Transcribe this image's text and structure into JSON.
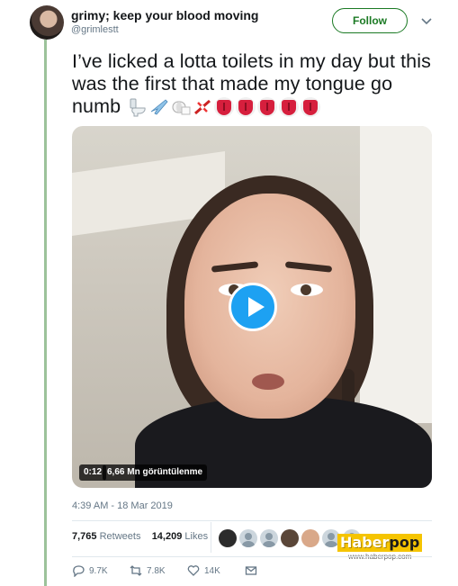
{
  "user": {
    "display_name": "grimy; keep your blood moving",
    "handle": "@grimlestt",
    "follow_label": "Follow"
  },
  "tweet": {
    "text": "I’ve licked a lotta toilets in my day but this was the first that made my tongue go numb",
    "emojis": [
      "toilet-emoji",
      "airplane-emoji",
      "toilet-paper-emoji",
      "small-airplane-emoji",
      "tongue-emoji",
      "tongue-emoji",
      "tongue-emoji",
      "tongue-emoji",
      "tongue-emoji"
    ]
  },
  "video": {
    "duration": "0:12",
    "views": "6,66 Mn görüntülenme"
  },
  "timestamp": "4:39 AM - 18 Mar 2019",
  "stats": {
    "retweets_count": "7,765",
    "retweets_label": "Retweets",
    "likes_count": "14,209",
    "likes_label": "Likes"
  },
  "watermark": {
    "brand": "Haber",
    "brand_suffix": "pop",
    "url": "www.haberpop.com"
  },
  "actions": {
    "replies": "9.7K",
    "retweets": "7.8K",
    "likes": "14K"
  },
  "colors": {
    "follow_green": "#1b7a24",
    "play_blue": "#1da1f2",
    "thread_line": "#9cc29a"
  }
}
